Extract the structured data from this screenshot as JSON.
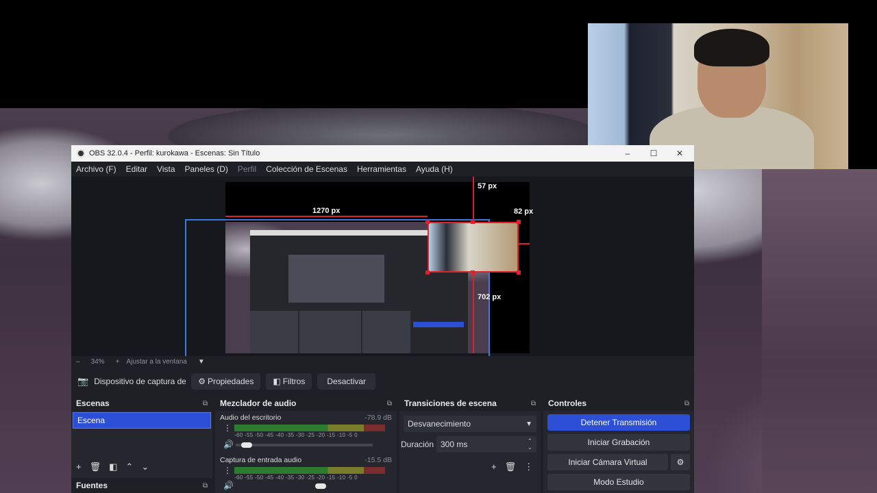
{
  "window": {
    "title": "OBS 32.0.4 - Perfil: kurokawa - Escenas: Sin Título"
  },
  "menu": [
    "Archivo (F)",
    "Editar",
    "Vista",
    "Paneles (D)",
    "Perfil",
    "Colección de Escenas",
    "Herramientas",
    "Ayuda (H)"
  ],
  "preview": {
    "measure_top": "57 px",
    "measure_right": "82 px",
    "measure_left": "1270 px",
    "measure_bottom": "702 px"
  },
  "zoom": {
    "minus": "–",
    "level": "34%",
    "plus": "+",
    "fit": "Ajustar a la ventana"
  },
  "source_bar": {
    "source_name": "Dispositivo de captura de v",
    "properties": "Propiedades",
    "filters": "Filtros",
    "deactivate": "Desactivar"
  },
  "docks": {
    "scenes": {
      "title": "Escenas",
      "items": [
        "Escena"
      ]
    },
    "sources": {
      "title": "Fuentes"
    },
    "mixer": {
      "title": "Mezclador de audio",
      "channels": [
        {
          "name": "Audio del escritorio",
          "db": "-78.9 dB"
        },
        {
          "name": "Captura de entrada audio",
          "db": "-15.5 dB"
        }
      ],
      "ticks": "-60 -55 -50 -45 -40 -35 -30 -25 -20 -15 -10 -5 0"
    },
    "transitions": {
      "title": "Transiciones de escena",
      "selected": "Desvanecimiento",
      "duration_label": "Duración",
      "duration_value": "300 ms"
    },
    "controls": {
      "title": "Controles",
      "stop_stream": "Detener Transmisión",
      "start_record": "Iniciar Grabación",
      "start_vcam": "Iniciar Cámara Virtual",
      "studio_mode": "Modo Estudio"
    }
  }
}
